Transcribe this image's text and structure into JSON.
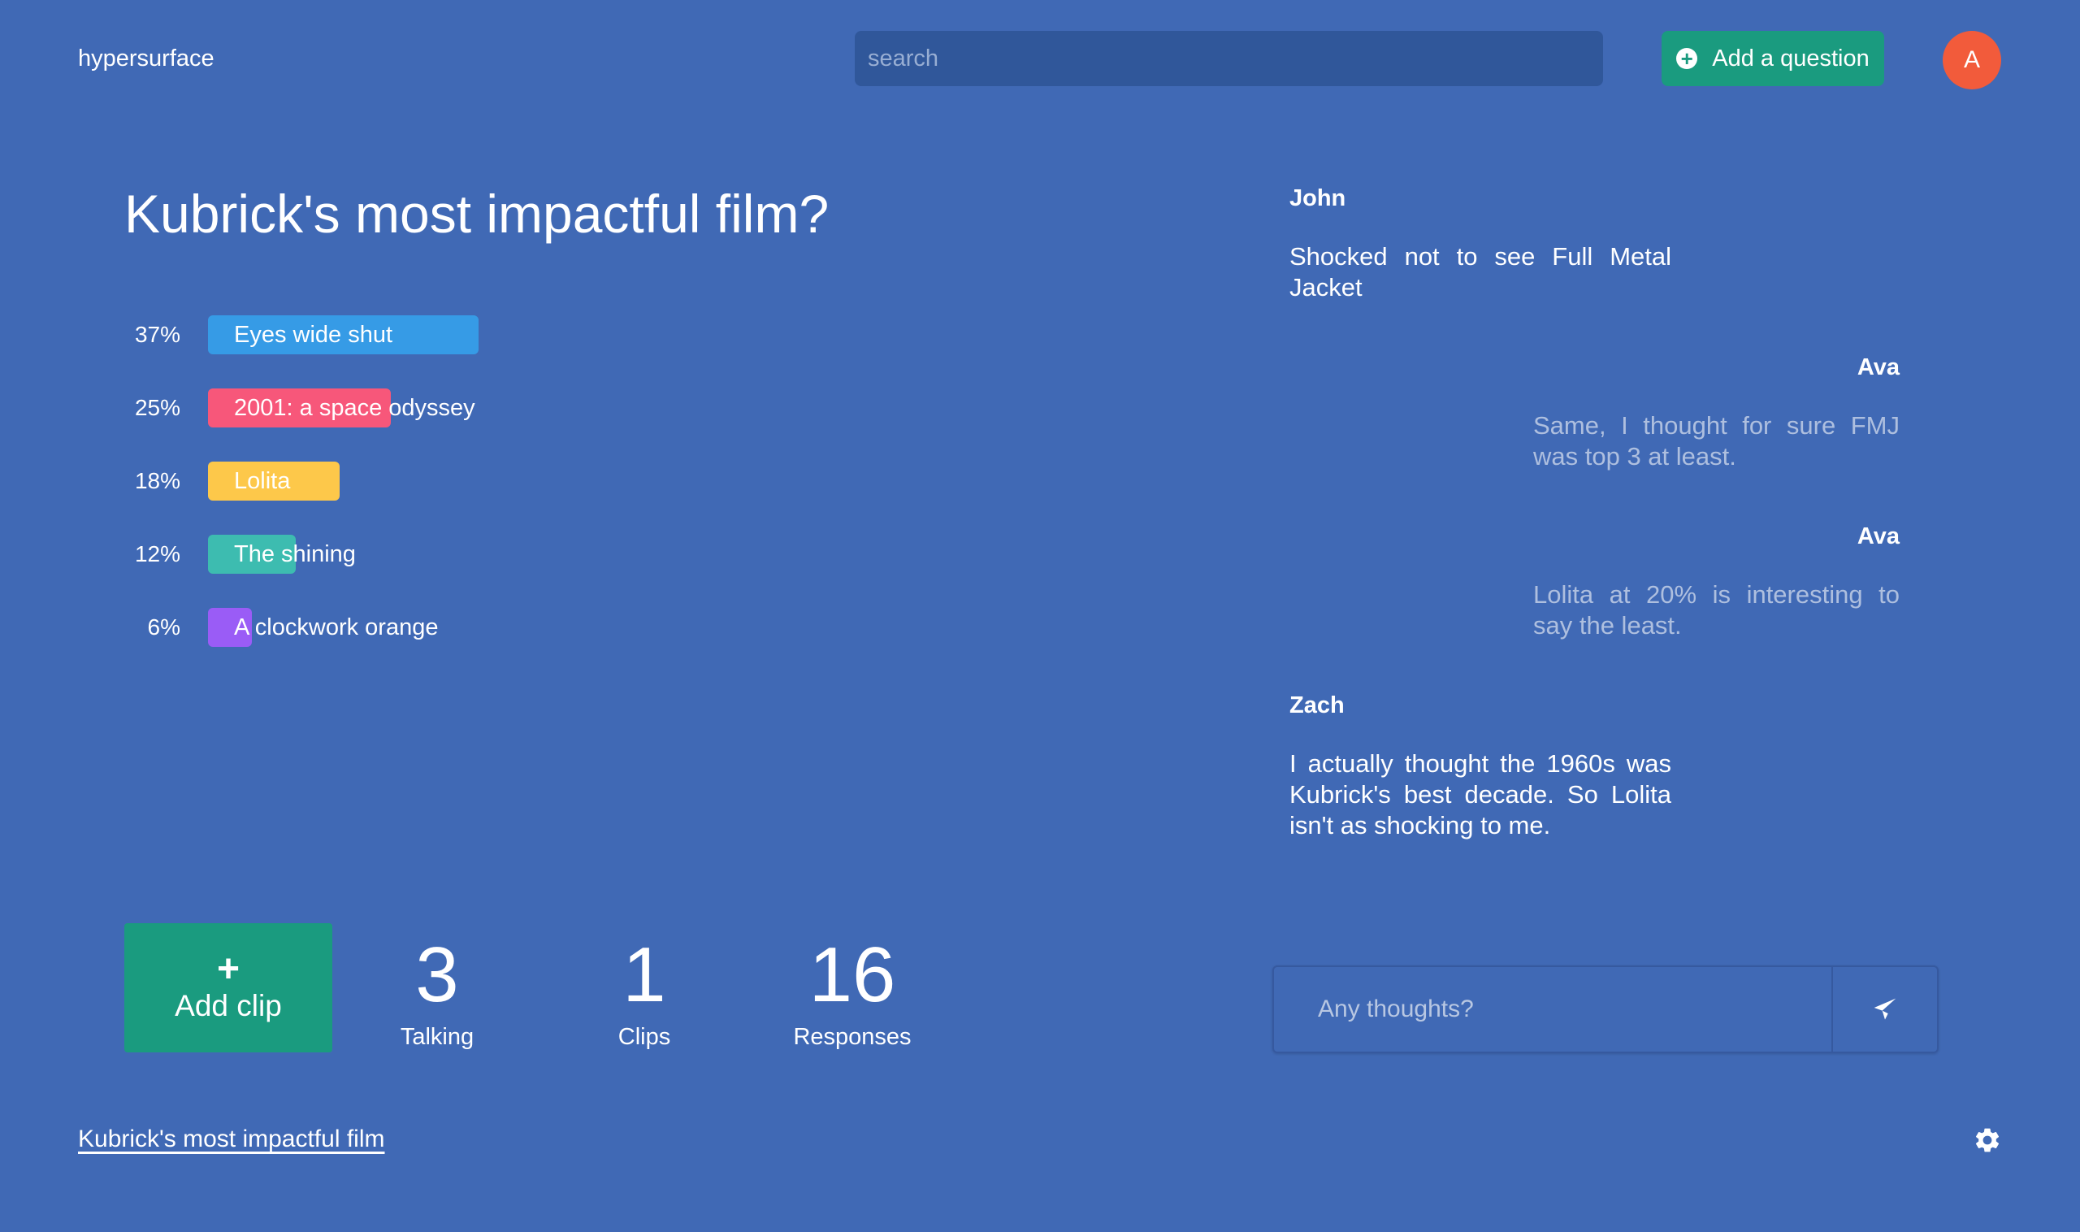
{
  "header": {
    "brand": "hypersurface",
    "search_placeholder": "search",
    "add_question_label": "Add a question",
    "avatar_initial": "A"
  },
  "question": {
    "title": "Kubrick's most impactful film?"
  },
  "poll": {
    "options": [
      {
        "percent_label": "37%",
        "percent": 37,
        "label": "Eyes wide shut",
        "color": "#369be6"
      },
      {
        "percent_label": "25%",
        "percent": 25,
        "label": "2001: a space odyssey",
        "color": "#f7577a"
      },
      {
        "percent_label": "18%",
        "percent": 18,
        "label": "Lolita",
        "color": "#fdc84a"
      },
      {
        "percent_label": "12%",
        "percent": 12,
        "label": "The shining",
        "color": "#3dbcb0"
      },
      {
        "percent_label": "6%",
        "percent": 6,
        "label": "A clockwork orange",
        "color": "#9a5cf6"
      }
    ]
  },
  "stats": {
    "add_clip_label": "Add clip",
    "talking": {
      "value": "3",
      "label": "Talking"
    },
    "clips": {
      "value": "1",
      "label": "Clips"
    },
    "responses": {
      "value": "16",
      "label": "Responses"
    }
  },
  "comments": [
    {
      "author": "John",
      "text": "Shocked not to see Full Metal Jacket"
    },
    {
      "author": "Ava",
      "text": "Same, I thought for sure FMJ was top 3 at least."
    },
    {
      "author": "Ava",
      "text": "Lolita at 20% is interesting to say the least."
    },
    {
      "author": "Zach",
      "text": "I actually thought the 1960s was Kubrick's best decade. So Lolita isn't as shocking to me."
    }
  ],
  "reply": {
    "placeholder": "Any thoughts?"
  },
  "footer": {
    "link_label": "Kubrick's most impactful film"
  }
}
